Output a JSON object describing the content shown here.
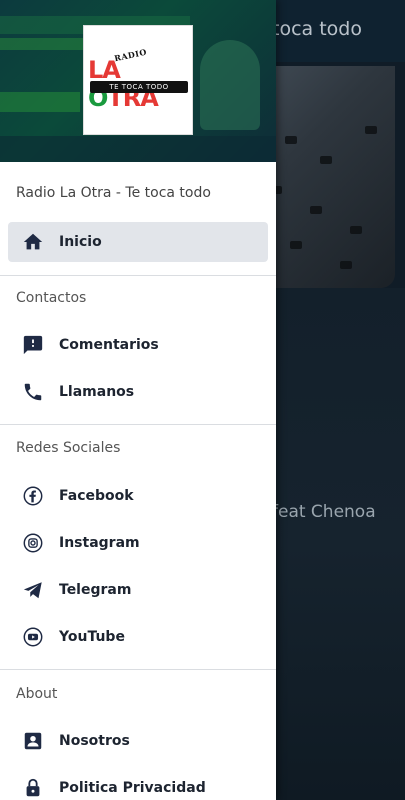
{
  "background": {
    "title": "toca todo",
    "track": "feat Chenoa"
  },
  "drawer": {
    "logo": {
      "small_text": "RADIO",
      "main_text_left": "LA ",
      "main_text_green": "O",
      "main_text_right": "TRA",
      "bar_text": "TE TOCA TODO"
    },
    "app_name": "Radio La Otra - Te toca todo",
    "items": {
      "inicio": {
        "label": "Inicio",
        "icon": "home-icon"
      },
      "comentarios": {
        "label": "Comentarios",
        "icon": "comment-icon"
      },
      "llamanos": {
        "label": "Llamanos",
        "icon": "phone-icon"
      },
      "facebook": {
        "label": "Facebook",
        "icon": "facebook-icon"
      },
      "instagram": {
        "label": "Instagram",
        "icon": "instagram-icon"
      },
      "telegram": {
        "label": "Telegram",
        "icon": "telegram-icon"
      },
      "youtube": {
        "label": "YouTube",
        "icon": "youtube-icon"
      },
      "nosotros": {
        "label": "Nosotros",
        "icon": "contact-card-icon"
      },
      "privacidad": {
        "label": "Politica Privacidad",
        "icon": "lock-icon"
      }
    },
    "sections": {
      "contactos": "Contactos",
      "redes": "Redes Sociales",
      "about": "About"
    }
  },
  "colors": {
    "icon": "#1f2a44",
    "active_bg": "#e2e5ea",
    "logo_red": "#e53935",
    "logo_green": "#1a9a3e"
  }
}
